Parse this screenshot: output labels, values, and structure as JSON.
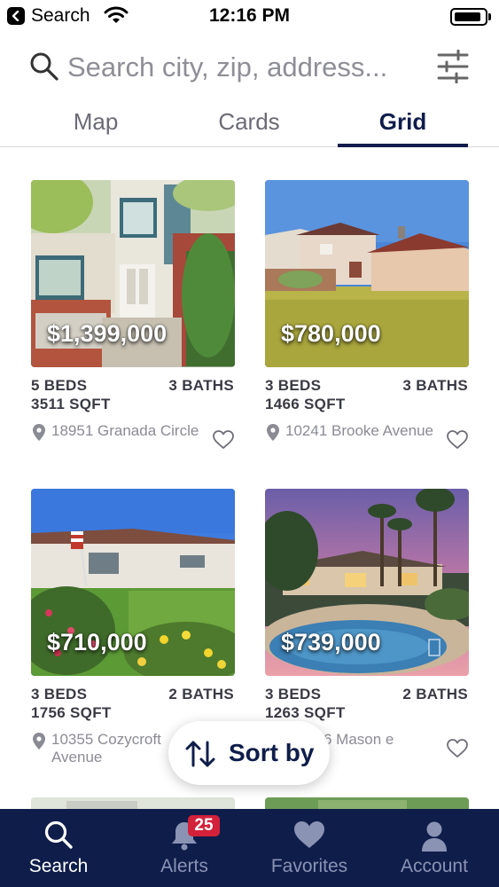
{
  "status_bar": {
    "back_label": "Search",
    "time": "12:16 PM"
  },
  "search": {
    "placeholder": "Search city, zip, address..."
  },
  "view_tabs": [
    {
      "label": "Map",
      "active": false
    },
    {
      "label": "Cards",
      "active": false
    },
    {
      "label": "Grid",
      "active": true
    }
  ],
  "listings": [
    {
      "price": "$1,399,000",
      "beds": "5 BEDS",
      "baths": "3 BATHS",
      "sqft": "3511 SQFT",
      "address": "18951 Granada Circle",
      "favorited": false
    },
    {
      "price": "$780,000",
      "beds": "3 BEDS",
      "baths": "3 BATHS",
      "sqft": "1466 SQFT",
      "address": "10241 Brooke Avenue",
      "favorited": false
    },
    {
      "price": "$710,000",
      "beds": "3 BEDS",
      "baths": "2 BATHS",
      "sqft": "1756 SQFT",
      "address": "10355 Cozycroft Avenue",
      "favorited": false
    },
    {
      "price": "$739,000",
      "beds": "3 BEDS",
      "baths": "2 BATHS",
      "sqft": "1263 SQFT",
      "address": "6 Mason e",
      "favorited": false
    }
  ],
  "sort_button": {
    "label": "Sort by"
  },
  "bottom_nav": [
    {
      "label": "Search",
      "icon": "search-icon",
      "active": true
    },
    {
      "label": "Alerts",
      "icon": "bell-icon",
      "badge": "25"
    },
    {
      "label": "Favorites",
      "icon": "heart-icon"
    },
    {
      "label": "Account",
      "icon": "person-icon"
    }
  ],
  "colors": {
    "navy": "#0f1d4a",
    "badge_red": "#d3213a",
    "muted_text": "#8b8b94"
  }
}
